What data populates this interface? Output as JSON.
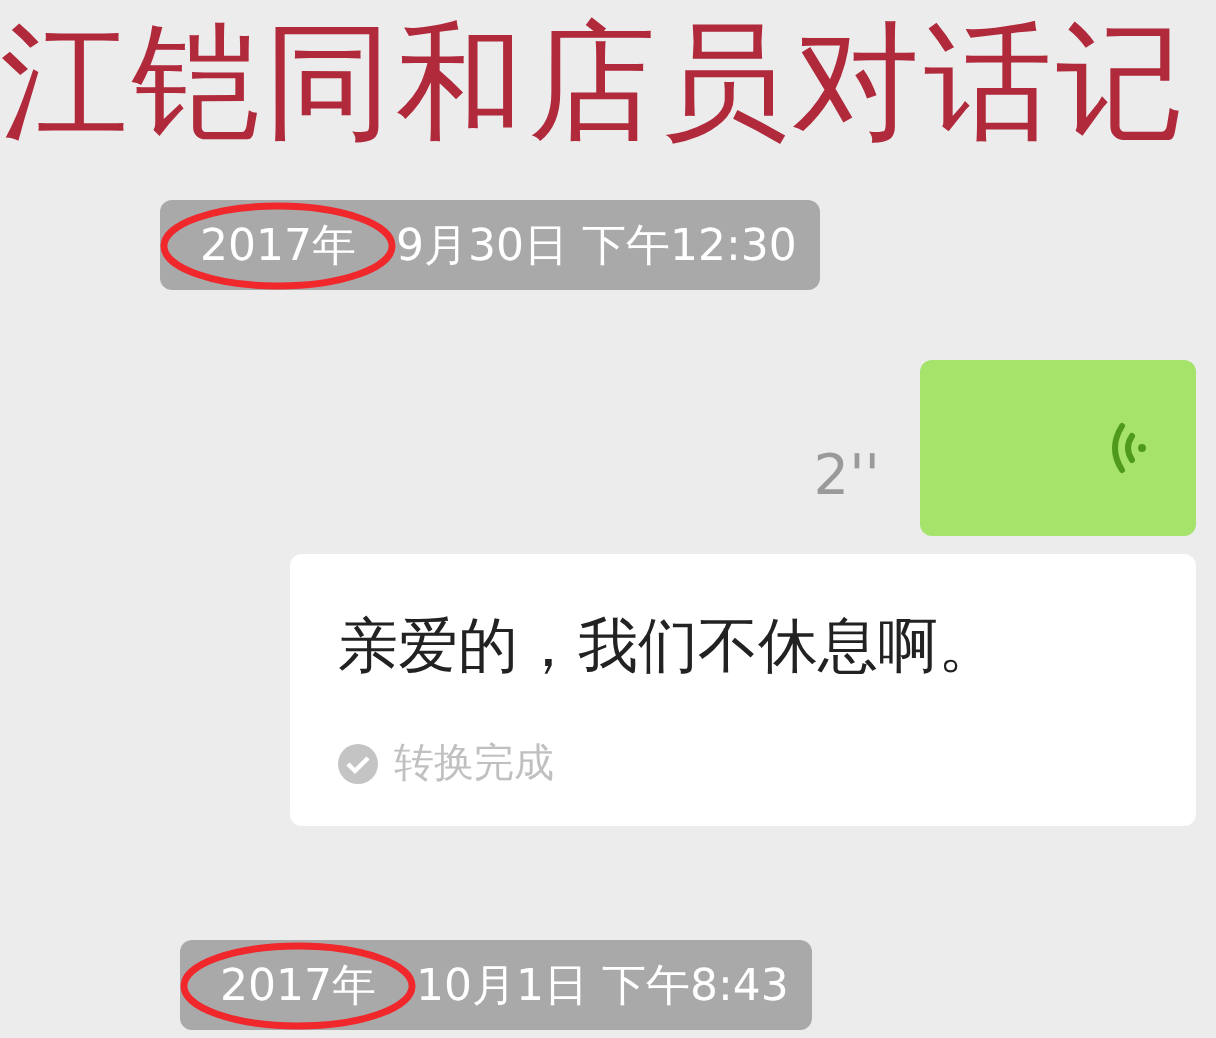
{
  "overlay_title": "江铠同和店员对话记",
  "messages": [
    {
      "kind": "timestamp",
      "circled_part": "2017年",
      "text": "9月30日 下午12:30",
      "circled": true
    },
    {
      "kind": "voice",
      "duration": "2''"
    },
    {
      "kind": "transcription",
      "text": "亲爱的，我们不休息啊。",
      "status": "转换完成"
    },
    {
      "kind": "timestamp",
      "circled_part": "2017年",
      "text": "10月1日 下午8:43",
      "circled": true
    }
  ]
}
